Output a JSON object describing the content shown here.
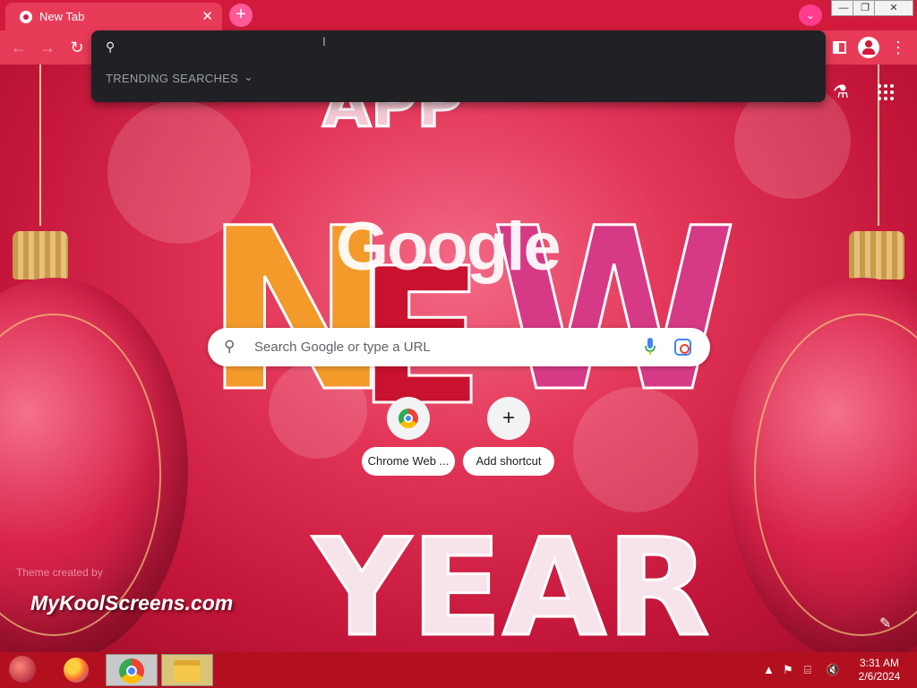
{
  "browser": {
    "tab": {
      "title": "New Tab",
      "close": "✕"
    },
    "new_tab": "+",
    "tab_search": "⌄",
    "window_controls": {
      "minimize": "—",
      "maximize": "❐",
      "close": "✕"
    }
  },
  "toolbar": {
    "back": "←",
    "forward": "→",
    "reload": "↻",
    "menu": "⋮"
  },
  "omnibox": {
    "value": "",
    "trending_label": "TRENDING SEARCHES",
    "trending_chevron": "⌄"
  },
  "ntp": {
    "logo": "Google",
    "search_placeholder": "Search Google or type a URL",
    "shortcuts": [
      {
        "label": "Chrome Web ...",
        "icon": "chrome-web-store-icon"
      },
      {
        "label": "Add shortcut",
        "icon": "plus-icon"
      }
    ],
    "theme_credit": "Theme created by",
    "watermark": "MyKoolScreens.com",
    "customize": "✎"
  },
  "taskbar": {
    "clock_time": "3:31 AM",
    "clock_date": "2/6/2024"
  },
  "colors": {
    "tab_bar": "#d21b3c",
    "toolbar": "#e83b58",
    "omnibox_bg": "#202124",
    "taskbar": "#b2101f"
  }
}
